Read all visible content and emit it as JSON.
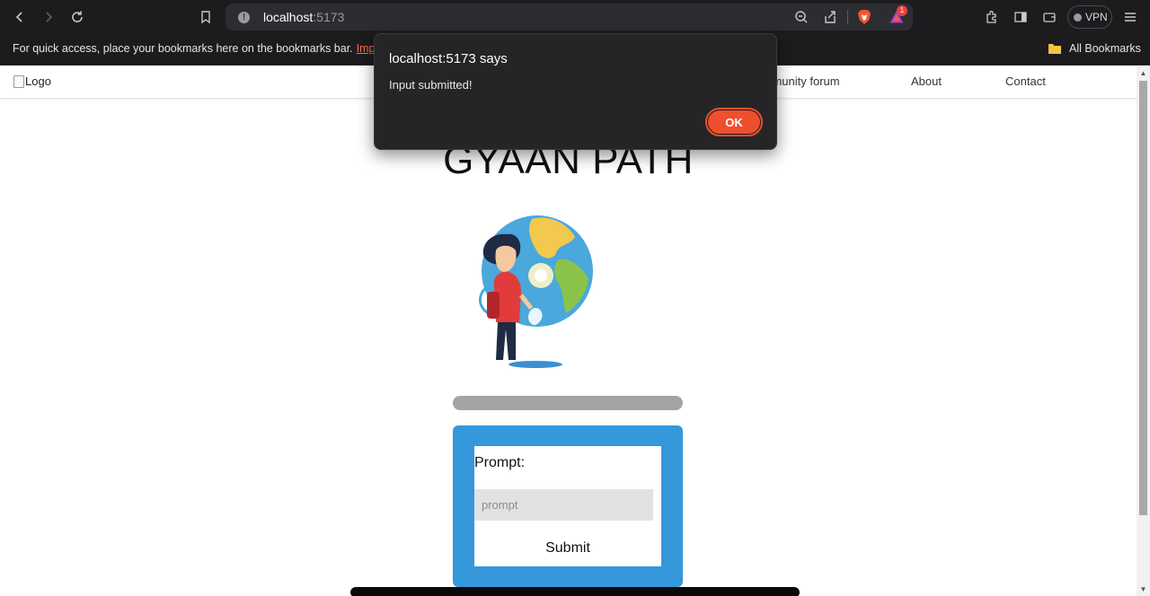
{
  "browser": {
    "url_host": "localhost",
    "url_port": ":5173",
    "vpn_label": "VPN",
    "rewards_badge": "1",
    "bookmarks_bar_text": "For quick access, place your bookmarks here on the bookmarks bar.",
    "bookmarks_import_link": "Import",
    "all_bookmarks_label": "All Bookmarks"
  },
  "page": {
    "logo_alt": "Logo",
    "nav": {
      "community": "Community forum",
      "about": "About",
      "contact": "Contact"
    },
    "title": "GYAAN PATH",
    "form": {
      "prompt_label": "Prompt:",
      "prompt_placeholder": "prompt",
      "submit_label": "Submit"
    }
  },
  "alert": {
    "title": "localhost:5173 says",
    "message": "Input submitted!",
    "ok_label": "OK"
  },
  "colors": {
    "card_blue": "#3498db",
    "ok_button": "#ee4f2e",
    "bookmark_link": "#ff6a4d"
  }
}
